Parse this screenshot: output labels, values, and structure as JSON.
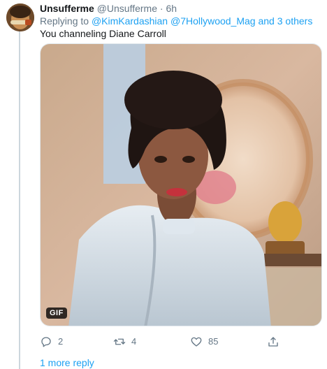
{
  "tweet": {
    "display_name": "Unsufferme",
    "handle": "@Unsufferme",
    "separator": "·",
    "time": "6h",
    "replying_prefix": "Replying to",
    "replying_users": "@KimKardashian @7Hollywood_Mag",
    "replying_and": "and",
    "replying_others": "3 others",
    "text": "You channeling Diane Carroll",
    "media_badge": "GIF"
  },
  "actions": {
    "reply_count": "2",
    "retweet_count": "4",
    "like_count": "85",
    "icons": [
      "reply-icon",
      "retweet-icon",
      "like-icon",
      "share-icon"
    ]
  },
  "footer": {
    "more_replies": "1 more reply"
  },
  "colors": {
    "link": "#1da1f2",
    "secondary_text": "#657786",
    "primary_text": "#14171a",
    "thread_line": "#ccd6dd"
  }
}
